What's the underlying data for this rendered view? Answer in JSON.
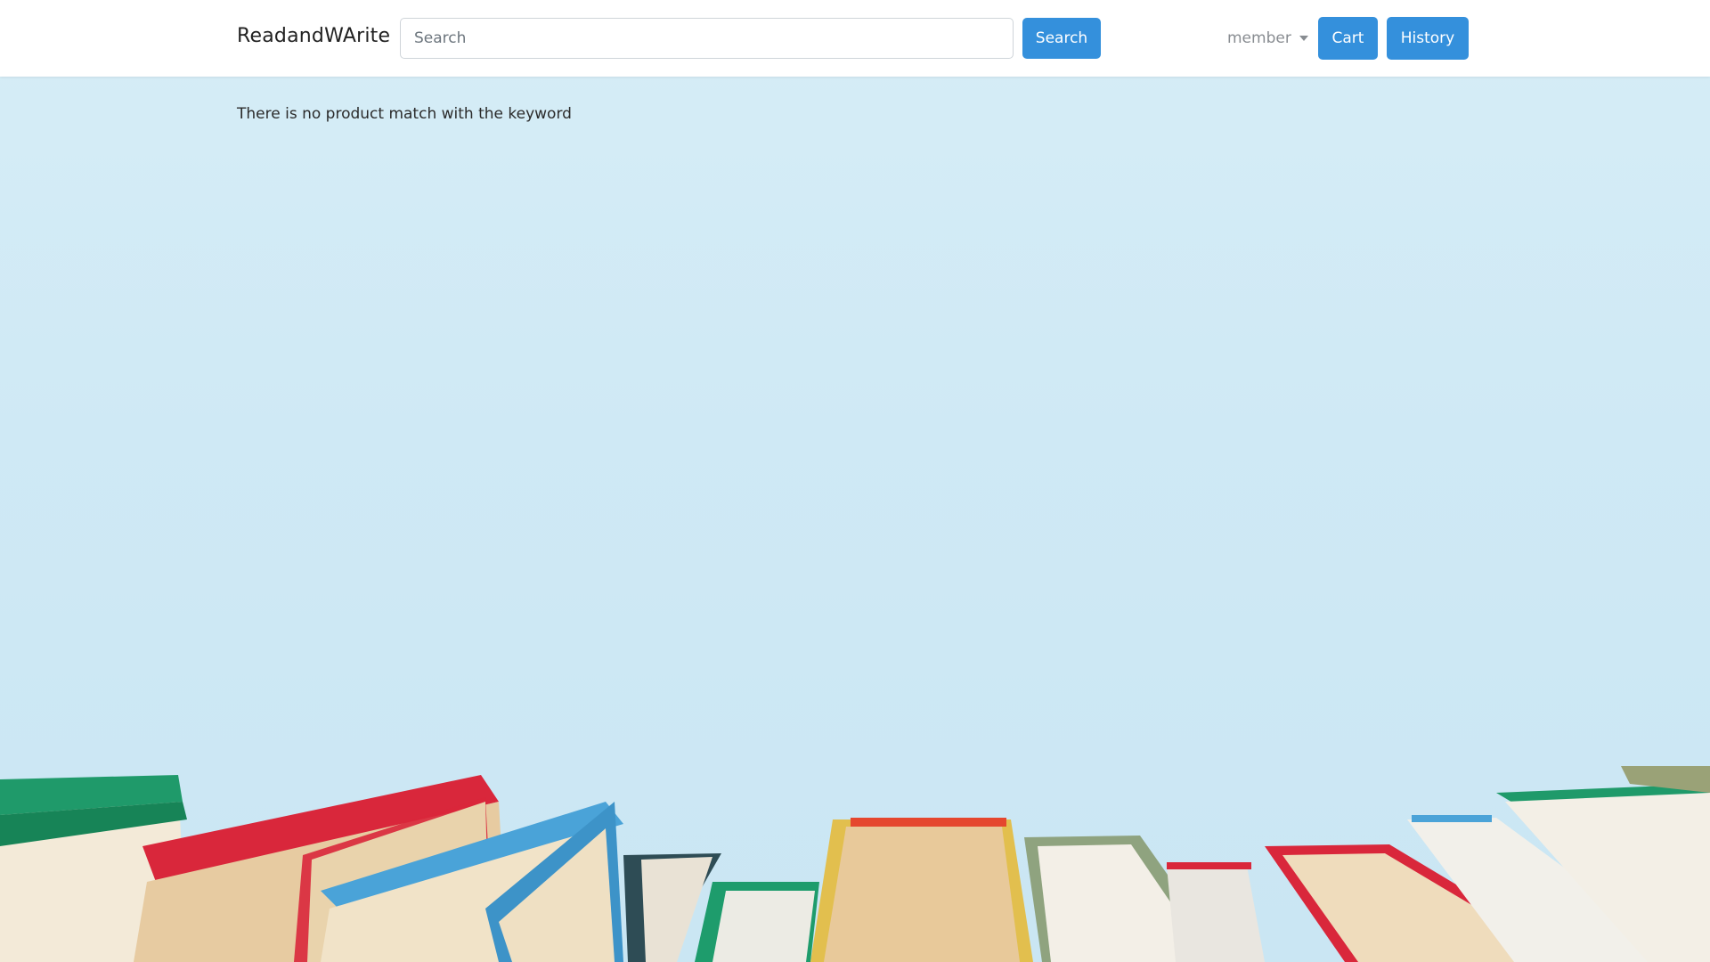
{
  "header": {
    "brand": "ReadandWArite",
    "search_placeholder": "Search",
    "search_value": "",
    "search_button": "Search",
    "member_label": "member",
    "cart_button": "Cart",
    "history_button": "History"
  },
  "main": {
    "message": "There is no product match with the keyword"
  },
  "colors": {
    "accent": "#3490dc",
    "background": "#d4ecf6"
  }
}
